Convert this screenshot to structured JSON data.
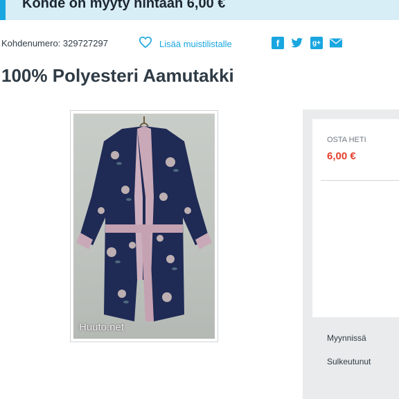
{
  "banner": {
    "text": "Kohde on myyty hintaan 6,00 €"
  },
  "meta": {
    "item_number": "Kohdenumero: 329727297",
    "watchlist_label": "Lisää muistilistalle"
  },
  "share": {
    "icons": [
      "facebook-icon",
      "twitter-icon",
      "google-plus-icon",
      "email-icon"
    ],
    "color": "#1aa6e0"
  },
  "product": {
    "title": "100% Polyesteri Aamutakki",
    "image_watermark": "Huuto.net"
  },
  "buy": {
    "label": "OSTA HETI",
    "price": "6,00 €",
    "price_color": "#e2402b"
  },
  "info": {
    "row1": "Myynnissä",
    "row2": "Sulkeutunut"
  },
  "colors": {
    "accent": "#1aa6e0",
    "banner_bg": "#d8eef7",
    "sidebar_bg": "#e9ebec"
  }
}
